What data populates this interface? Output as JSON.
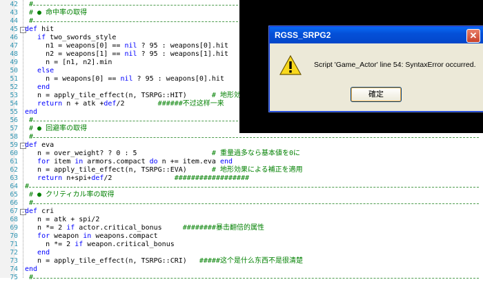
{
  "editor": {
    "lines": [
      {
        "n": "42",
        "code": "#",
        "kind": "sep"
      },
      {
        "n": "43",
        "code": "# ● 命中率の取得",
        "kind": "comment"
      },
      {
        "n": "44",
        "code": "#",
        "kind": "sep"
      },
      {
        "n": "45",
        "code": "def hit",
        "fold": "-"
      },
      {
        "n": "46",
        "code": "  if two_swords_style"
      },
      {
        "n": "47",
        "code": "    n1 = weapons[0] == nil ? 95 : weapons[0].hit"
      },
      {
        "n": "48",
        "code": "    n2 = weapons[1] == nil ? 95 : weapons[1].hit"
      },
      {
        "n": "49",
        "code": "    n = [n1, n2].min"
      },
      {
        "n": "50",
        "code": "  else"
      },
      {
        "n": "51",
        "code": "    n = weapons[0] == nil ? 95 : weapons[0].hit"
      },
      {
        "n": "52",
        "code": "  end"
      },
      {
        "n": "53",
        "code": "  n = apply_tile_effect(n, TSRPG::HIT)      # 地形効"
      },
      {
        "n": "54",
        "code": "  return n + atk +def/2        ######不过这样一来"
      },
      {
        "n": "55",
        "code": "end"
      },
      {
        "n": "56",
        "code": "#",
        "kind": "sep"
      },
      {
        "n": "57",
        "code": "# ● 回避率の取得",
        "kind": "comment"
      },
      {
        "n": "58",
        "code": "#",
        "kind": "sep"
      },
      {
        "n": "59",
        "code": "def eva",
        "fold": "-"
      },
      {
        "n": "60",
        "code": "  n = over_weight? ? 0 : 5                  # 重量過多なら基本値を0に"
      },
      {
        "n": "61",
        "code": "  for item in armors.compact do n += item.eva end"
      },
      {
        "n": "62",
        "code": "  n = apply_tile_effect(n, TSRPG::EVA)      # 地形効果による補正を適用"
      },
      {
        "n": "63",
        "code": "  return n+spi+def/2               ##################"
      },
      {
        "n": "64",
        "code": "#",
        "kind": "sepfull"
      },
      {
        "n": "65",
        "code": "# ● クリティカル率の取得",
        "kind": "comment"
      },
      {
        "n": "66",
        "code": "#",
        "kind": "sep"
      },
      {
        "n": "67",
        "code": "def cri",
        "fold": "-"
      },
      {
        "n": "68",
        "code": "  n = atk + spi/2"
      },
      {
        "n": "69",
        "code": "  n *= 2 if actor.critical_bonus     ########暴击翻倍的属性"
      },
      {
        "n": "70",
        "code": "  for weapon in weapons.compact"
      },
      {
        "n": "71",
        "code": "    n *= 2 if weapon.critical_bonus"
      },
      {
        "n": "72",
        "code": "  end"
      },
      {
        "n": "73",
        "code": "  n = apply_tile_effect(n, TSRPG::CRI)   #####这个是什么东西不是很清楚"
      },
      {
        "n": "74",
        "code": "end"
      },
      {
        "n": "75",
        "code": "#",
        "kind": "sep"
      }
    ]
  },
  "dialog": {
    "title": "RGSS_SRPG2",
    "close_label": "✕",
    "icon": "warning-icon",
    "message": "Script 'Game_Actor' line 54: SyntaxError occurred.",
    "ok_label": "確定"
  },
  "colors": {
    "comment": "#008000",
    "keyword": "#0000ff",
    "line_number": "#2b91af",
    "titlebar": "#0450d8"
  }
}
